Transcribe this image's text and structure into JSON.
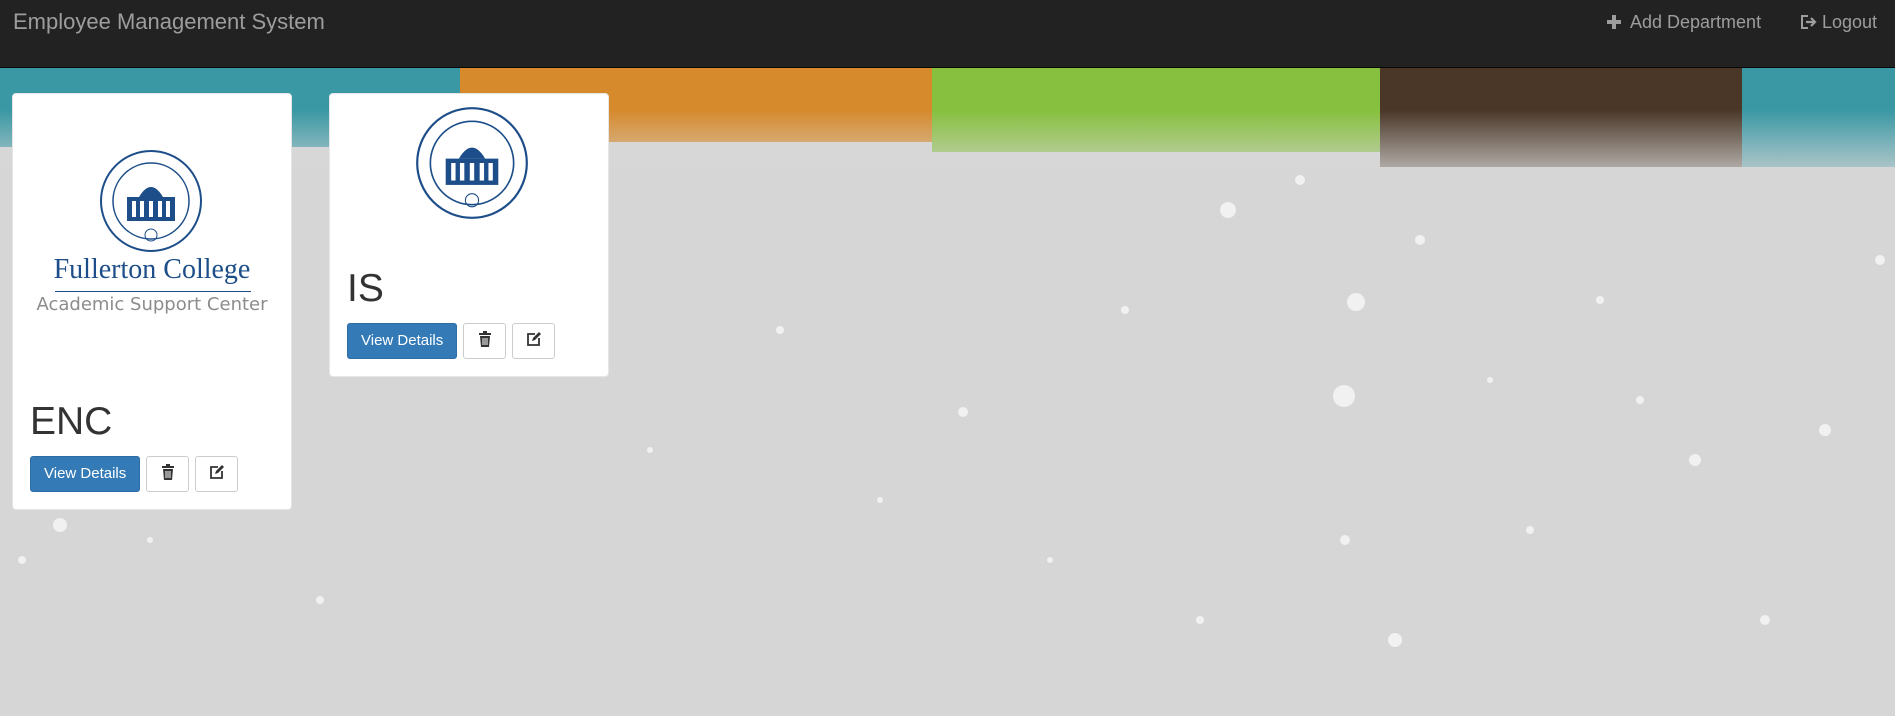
{
  "navbar": {
    "brand": "Employee Management System",
    "add_department": "Add Department",
    "logout": "Logout"
  },
  "departments": [
    {
      "name": "ENC",
      "logo_line1": "Fullerton College",
      "logo_line2": "Academic Support Center",
      "view_label": "View Details"
    },
    {
      "name": "IS",
      "view_label": "View Details"
    }
  ],
  "icons": {
    "add": "plus-icon",
    "logout": "logout-icon",
    "delete": "trash-icon",
    "edit": "edit-icon"
  },
  "colors": {
    "navbar": "#222222",
    "nav_text": "#9d9d9d",
    "primary": "#337ab7",
    "brush_teal": "#3a98a4",
    "brush_orange": "#d68a2c",
    "brush_green": "#86c03e",
    "brush_brown": "#4a3728",
    "seal": "#1d4e89"
  }
}
